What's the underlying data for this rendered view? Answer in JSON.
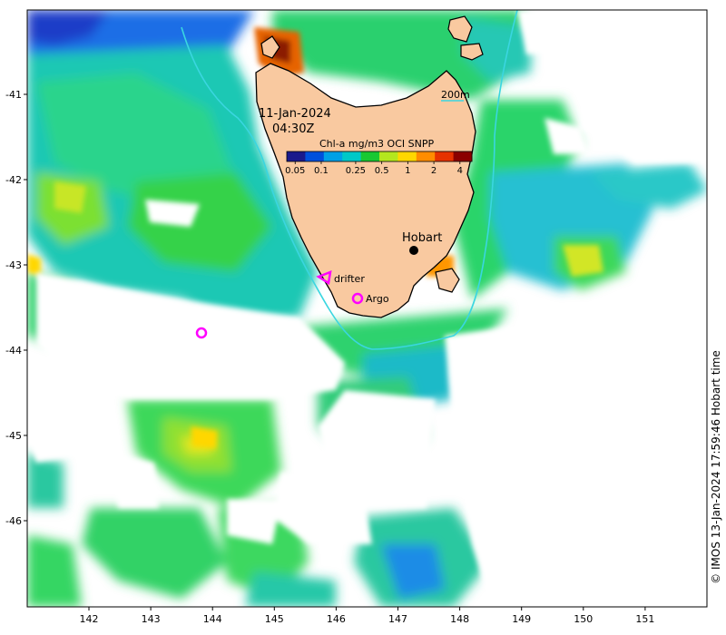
{
  "map": {
    "date": "11-Jan-2024",
    "time": "04:30Z",
    "colorbar_title": "Chl-a mg/m3 OCI SNPP",
    "colorbar_ticks": [
      "0.05",
      "0.1",
      "0.25",
      "0.5",
      "1",
      "2",
      "4"
    ],
    "colorbar_colors": [
      "#1a1a8c",
      "#0050dc",
      "#00a0e6",
      "#00c8c8",
      "#19c832",
      "#b4e61e",
      "#ffd700",
      "#ff8c00",
      "#e63200",
      "#8b0000"
    ],
    "contour_label": "200m",
    "colors": {
      "land": "#f9c9a0",
      "coastline": "#000000",
      "contour_200m": "#3ad6e0",
      "markers": "#ff00ff",
      "cloud_or_nodata": "#ffffff"
    },
    "places": [
      {
        "name": "Hobart",
        "icon": "city-dot-icon"
      }
    ],
    "markers": [
      {
        "label": "drifter",
        "icon": "triangle-marker-icon"
      },
      {
        "label": "Argo",
        "icon": "circle-marker-icon"
      },
      {
        "label": "",
        "icon": "circle-marker-icon"
      }
    ],
    "x_ticks": [
      "142",
      "143",
      "144",
      "145",
      "146",
      "147",
      "148",
      "149",
      "150",
      "151"
    ],
    "y_ticks": [
      "-41",
      "-42",
      "-43",
      "-44",
      "-45",
      "-46"
    ],
    "credit": "© IMOS 13-Jan-2024 17:59:46 Hobart time"
  }
}
